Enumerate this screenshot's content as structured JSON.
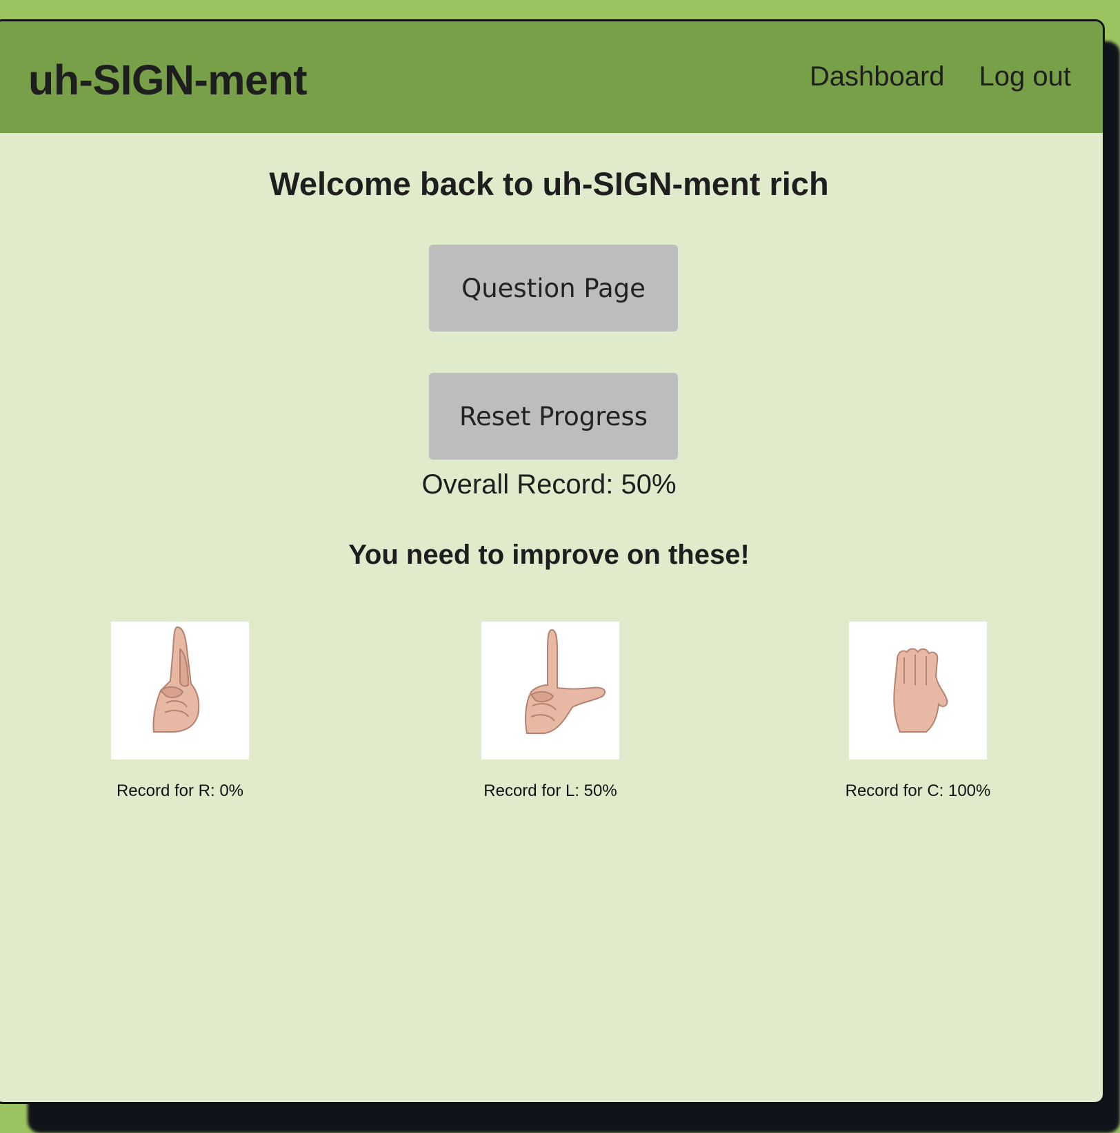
{
  "header": {
    "brand": "uh-SIGN-ment",
    "nav": [
      {
        "label": "Dashboard"
      },
      {
        "label": "Log out"
      }
    ]
  },
  "main": {
    "welcome": "Welcome back to uh-SIGN-ment rich",
    "question_button": "Question Page",
    "reset_button": "Reset Progress",
    "overall_record": "Overall Record: 50%",
    "improve_heading": "You need to improve on these!",
    "cards": [
      {
        "letter": "R",
        "caption": "Record for R: 0%",
        "icon": "hand-sign-r-icon"
      },
      {
        "letter": "L",
        "caption": "Record for L: 50%",
        "icon": "hand-sign-l-icon"
      },
      {
        "letter": "C",
        "caption": "Record for C: 100%",
        "icon": "hand-sign-c-icon"
      }
    ]
  },
  "colors": {
    "page_background": "#9bc35f",
    "header_background": "#77a048",
    "content_background": "#dfebcb",
    "button_background": "#bdbdbd"
  }
}
